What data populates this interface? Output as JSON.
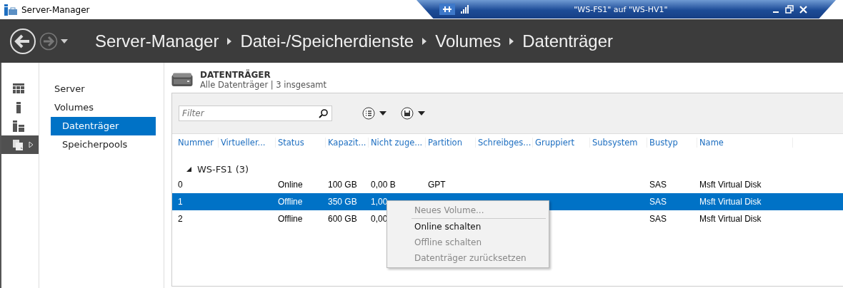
{
  "window": {
    "title": "Server-Manager"
  },
  "remote_bar": {
    "title": "\"WS-FS1\" auf \"WS-HV1\""
  },
  "breadcrumb": [
    "Server-Manager",
    "Datei-/Speicherdienste",
    "Volumes",
    "Datenträger"
  ],
  "icon_strip": [
    {
      "kind": "dashboard",
      "selected": false
    },
    {
      "kind": "server",
      "selected": false
    },
    {
      "kind": "servers",
      "selected": false
    },
    {
      "kind": "files",
      "selected": true
    }
  ],
  "nav": {
    "items": [
      {
        "label": "Server",
        "selected": false
      },
      {
        "label": "Volumes",
        "selected": false,
        "children": [
          {
            "label": "Datenträger",
            "selected": true
          },
          {
            "label": "Speicherpools",
            "selected": false
          }
        ]
      }
    ]
  },
  "panel": {
    "title": "DATENTRÄGER",
    "subtitle": "Alle Datenträger | 3 insgesamt",
    "filter": {
      "placeholder": "Filter"
    }
  },
  "table": {
    "columns": [
      "Nummer",
      "Virtueller...",
      "Status",
      "Kapazit...",
      "Nicht zuge...",
      "Partition",
      "Schreibges...",
      "Gruppiert",
      "Subsystem",
      "Bustyp",
      "Name"
    ],
    "group": {
      "label": "WS-FS1 (3)",
      "expanded": true
    },
    "rows": [
      {
        "selected": false,
        "cells": [
          "0",
          "",
          "Online",
          "100 GB",
          "0,00 B",
          "GPT",
          "",
          "",
          "",
          "SAS",
          "Msft Virtual Disk"
        ]
      },
      {
        "selected": true,
        "cells": [
          "1",
          "",
          "Offline",
          "350 GB",
          "1,00",
          "",
          "",
          "",
          "",
          "SAS",
          "Msft Virtual Disk"
        ]
      },
      {
        "selected": false,
        "cells": [
          "2",
          "",
          "Offline",
          "600 GB",
          "0,00",
          "",
          "",
          "",
          "",
          "SAS",
          "Msft Virtual Disk"
        ]
      }
    ]
  },
  "context_menu": [
    {
      "label": "Neues Volume...",
      "disabled": true,
      "separator_after": true
    },
    {
      "label": "Online schalten",
      "disabled": false,
      "separator_after": false
    },
    {
      "label": "Offline schalten",
      "disabled": true,
      "separator_after": false
    },
    {
      "label": "Datenträger zurücksetzen",
      "disabled": true,
      "separator_after": false
    }
  ]
}
